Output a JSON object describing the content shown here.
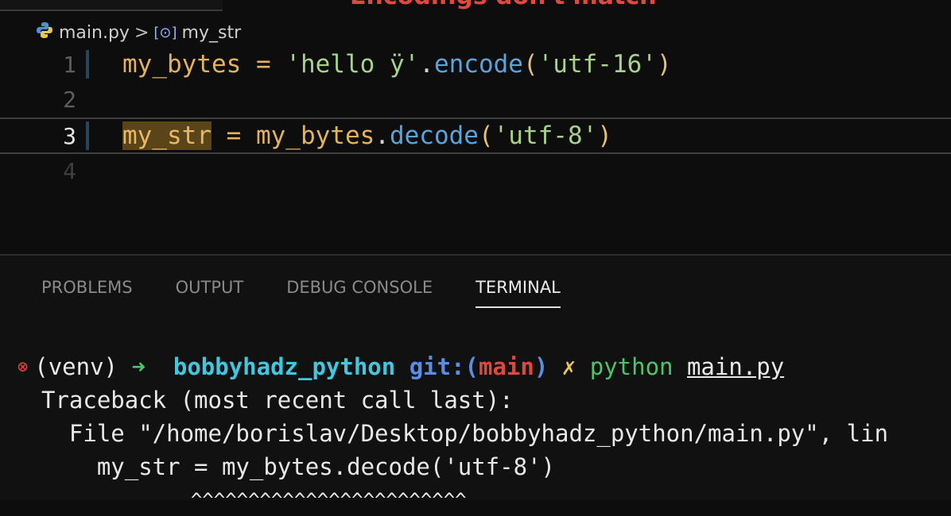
{
  "annotation": {
    "text": "Encodings don't match",
    "color": "#e0483e"
  },
  "breadcrumb": {
    "file": "main.py",
    "separator": ">",
    "symbol_icon": "variable-icon",
    "symbol": "my_str"
  },
  "editor": {
    "lines": [
      {
        "number": "1",
        "var": "my_bytes",
        "op": " = ",
        "str1": "'hello ÿ'",
        "dot": ".",
        "fn": "encode",
        "lp": "(",
        "arg": "'utf-16'",
        "rp": ")"
      },
      {
        "number": "2"
      },
      {
        "number": "3",
        "var": "my_str",
        "op": " = ",
        "obj": "my_bytes",
        "dot": ".",
        "fn": "decode",
        "lp": "(",
        "arg": "'utf-8'",
        "rp": ")"
      },
      {
        "number": "4"
      }
    ]
  },
  "panel": {
    "tabs": [
      {
        "label": "PROBLEMS",
        "active": false
      },
      {
        "label": "OUTPUT",
        "active": false
      },
      {
        "label": "DEBUG CONSOLE",
        "active": false
      },
      {
        "label": "TERMINAL",
        "active": true
      }
    ]
  },
  "terminal": {
    "prompt": {
      "status_icon": "error-circle-icon",
      "venv": "(venv)",
      "arrow": "➜",
      "dir": "bobbyhadz_python",
      "git_open": "git:(",
      "branch": "main",
      "git_close": ")",
      "dirty": "✗",
      "cmd": "python",
      "arg": "main.py"
    },
    "lines": [
      "Traceback (most recent call last):",
      "  File \"/home/borislav/Desktop/bobbyhadz_python/main.py\", lin",
      "    my_str = my_bytes.decode('utf-8')",
      "             ^^^^^^^^^^^^^^^^^^^^^^^^"
    ]
  }
}
